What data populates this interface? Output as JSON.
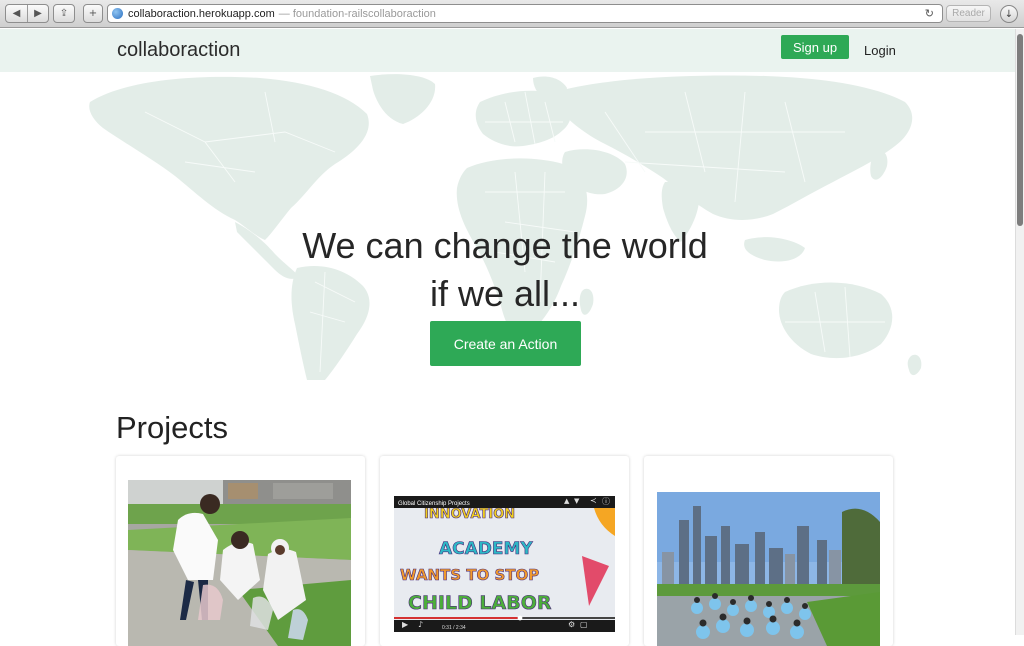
{
  "browser": {
    "url_host": "collaboraction.herokuapp.com",
    "url_suffix": "— foundation-railscollaboraction",
    "reader_label": "Reader"
  },
  "navbar": {
    "brand": "collaboraction",
    "signup_label": "Sign up",
    "login_label": "Login"
  },
  "hero": {
    "headline_line1": "We can change the world",
    "headline_line2": "if we all...",
    "cta_label": "Create an Action"
  },
  "projects": {
    "title": "Projects",
    "video_title": "Global Citizenship Projects",
    "video_time": "0:31 / 2:34",
    "video_sign_lines": [
      "INNOVATION",
      "ACADEMY",
      "WANTS TO STOP",
      "CHILD LABOR"
    ]
  },
  "colors": {
    "accent": "#2ea956",
    "navbar_bg": "#eaf3ef",
    "map_fill": "#e3ede8"
  }
}
